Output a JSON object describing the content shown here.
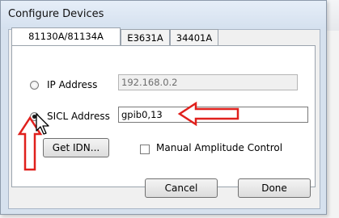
{
  "dialog": {
    "title": "Configure Devices"
  },
  "tabs": [
    {
      "label": "81130A/81134A",
      "active": true
    },
    {
      "label": "E3631A",
      "active": false
    },
    {
      "label": "34401A",
      "active": false
    }
  ],
  "connection": {
    "ip_label": "IP Address",
    "ip_value": "192.168.0.2",
    "ip_selected": false,
    "sicl_label": "SICL Address",
    "sicl_value": "gpib0,13",
    "sicl_selected": true
  },
  "get_idn_label": "Get IDN...",
  "manual_amplitude": {
    "label": "Manual Amplitude Control",
    "checked": false
  },
  "footer": {
    "cancel_label": "Cancel",
    "done_label": "Done"
  },
  "annotation_color": "#e0201c",
  "icons": {
    "annotation_arrows": "red-outline-arrow-icon",
    "cursor": "mouse-pointer-icon"
  }
}
